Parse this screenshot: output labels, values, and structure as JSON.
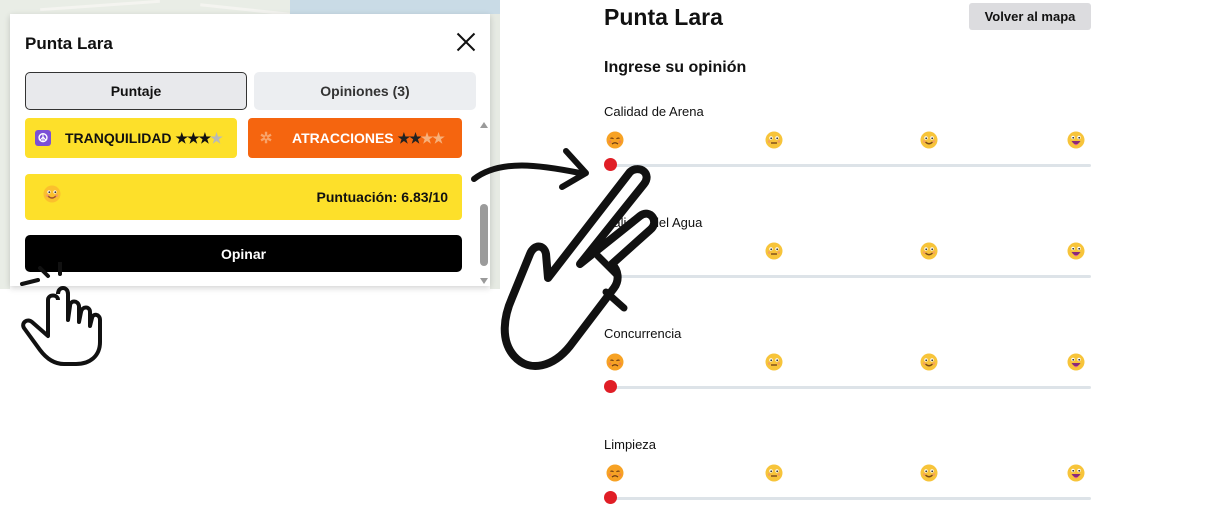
{
  "popup": {
    "title": "Punta Lara",
    "tabs": [
      {
        "label": "Puntaje",
        "active": true
      },
      {
        "label": "Opiniones (3)",
        "active": false
      }
    ],
    "badges": [
      {
        "label": "TRANQUILIDAD",
        "stars_filled": "★★★",
        "stars_empty": "★",
        "icon": "peace-icon",
        "color": "#fde02a"
      },
      {
        "label": "ATRACCIONES",
        "stars_filled": "★★",
        "stars_empty": "★★",
        "icon": "ferris-wheel-icon",
        "color": "#f5650f"
      }
    ],
    "score": {
      "text": "Puntuación: 6.83/10",
      "icon": "smile-face-icon"
    },
    "opinar_label": "Opinar"
  },
  "form": {
    "title": "Punta Lara",
    "back_label": "Volver al mapa",
    "heading": "Ingrese su opinión",
    "criteria": [
      {
        "label": "Calidad de Arena",
        "value": 0
      },
      {
        "label": "Calidad del Agua",
        "value": 0
      },
      {
        "label": "Concurrencia",
        "value": 0
      },
      {
        "label": "Limpieza",
        "value": 0
      }
    ],
    "scale_icons": [
      "sad-face-icon",
      "neutral-face-icon",
      "smile-face-icon",
      "grin-face-icon"
    ]
  },
  "colors": {
    "accent_yellow": "#fde02a",
    "accent_orange": "#f5650f",
    "slider_thumb": "#e01e26",
    "button_dark": "#000000"
  }
}
